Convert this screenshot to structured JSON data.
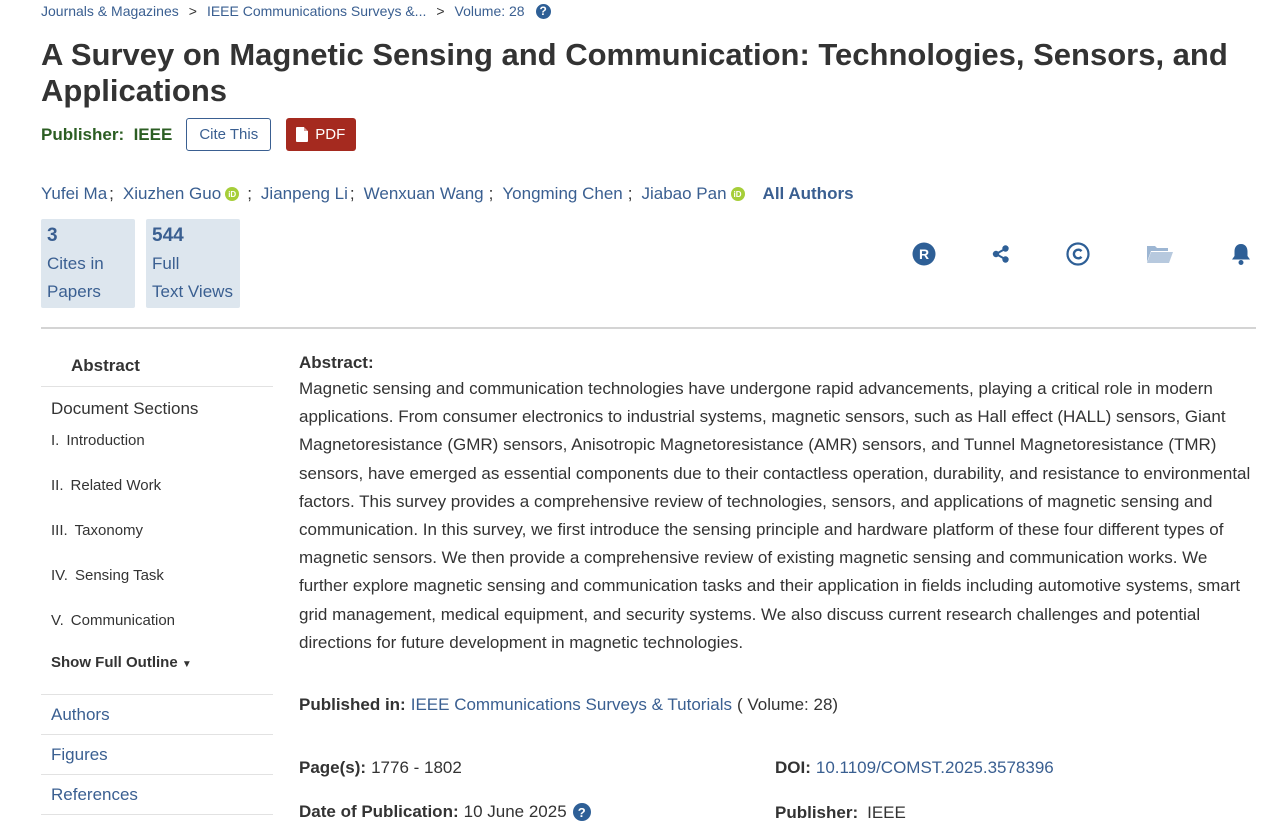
{
  "breadcrumb": {
    "items": [
      "Journals & Magazines",
      "IEEE Communications Surveys &...",
      "Volume: 28"
    ],
    "separator": ">"
  },
  "title": "A Survey on Magnetic Sensing and Communication: Technologies, Sensors, and Applications",
  "publisher_row": {
    "label": "Publisher:",
    "value": "IEEE",
    "cite_button": "Cite This",
    "pdf_button": "PDF"
  },
  "authors": {
    "list": [
      {
        "name": "Yufei Ma",
        "orcid": false
      },
      {
        "name": "Xiuzhen Guo",
        "orcid": true
      },
      {
        "name": "Jianpeng Li",
        "orcid": false
      },
      {
        "name": "Wenxuan Wang",
        "orcid": false
      },
      {
        "name": "Yongming Chen",
        "orcid": false
      },
      {
        "name": "Jiabao Pan",
        "orcid": true
      }
    ],
    "separator": ";",
    "all_authors_label": "All Authors"
  },
  "metrics": [
    {
      "value": "3",
      "line1": "Cites in",
      "line2": "Papers"
    },
    {
      "value": "544",
      "line1": "Full",
      "line2": "Text Views"
    }
  ],
  "toolbar_icons": [
    "rights-icon",
    "share-icon",
    "copyright-icon",
    "folder-icon",
    "bell-icon"
  ],
  "sidebar": {
    "abstract": "Abstract",
    "document_sections": "Document Sections",
    "sections": [
      {
        "num": "I.",
        "label": "Introduction"
      },
      {
        "num": "II.",
        "label": "Related Work"
      },
      {
        "num": "III.",
        "label": "Taxonomy"
      },
      {
        "num": "IV.",
        "label": "Sensing Task"
      },
      {
        "num": "V.",
        "label": "Communication"
      }
    ],
    "show_full_outline": "Show Full Outline",
    "links": [
      "Authors",
      "Figures",
      "References"
    ]
  },
  "abstract": {
    "heading": "Abstract:",
    "text": "Magnetic sensing and communication technologies have undergone rapid advancements, playing a critical role in modern applications. From consumer electronics to industrial systems, magnetic sensors, such as Hall effect (HALL) sensors, Giant Magnetoresistance (GMR) sensors, Anisotropic Magnetoresistance (AMR) sensors, and Tunnel Magnetoresistance (TMR) sensors, have emerged as essential components due to their contactless operation, durability, and resistance to environmental factors. This survey provides a comprehensive review of technologies, sensors, and applications of magnetic sensing and communication. In this survey, we first introduce the sensing principle and hardware platform of these four different types of magnetic sensors. We then provide a comprehensive review of existing magnetic sensing and communication works. We further explore magnetic sensing and communication tasks and their application in fields including automotive systems, smart grid management, medical equipment, and security systems. We also discuss current research challenges and potential directions for future development in magnetic technologies."
  },
  "published_in": {
    "label": "Published in:",
    "journal": "IEEE Communications Surveys & Tutorials",
    "volume": "( Volume: 28)"
  },
  "details": {
    "pages_label": "Page(s):",
    "pages": "1776 - 1802",
    "doi_label": "DOI:",
    "doi": "10.1109/COMST.2025.3578396",
    "date_label": "Date of Publication:",
    "date": "10 June 2025",
    "publisher_label": "Publisher:",
    "publisher": "IEEE"
  },
  "colors": {
    "link": "#3a5f91",
    "pdf_button": "#a52a1f",
    "publisher_label": "#2c5e23",
    "metric_bg": "#dde6ee",
    "orcid": "#a6ce39"
  }
}
